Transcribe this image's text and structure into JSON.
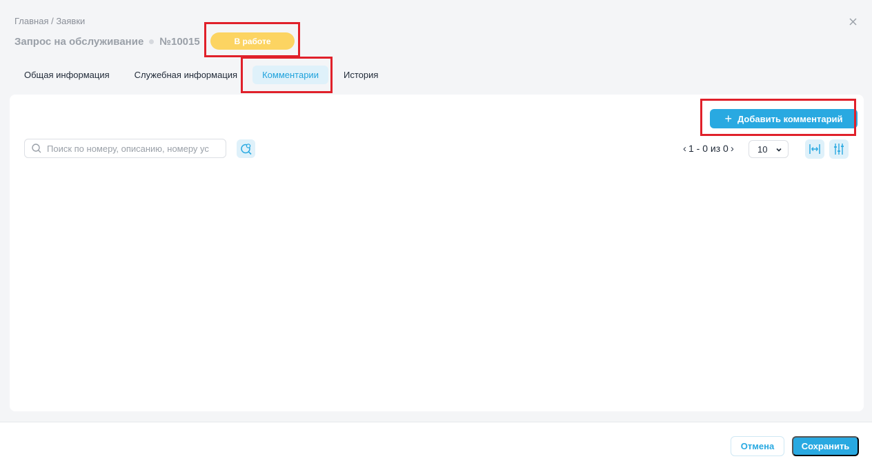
{
  "breadcrumb": "Главная / Заявки",
  "header": {
    "title": "Запрос на обслуживание",
    "number": "№10015",
    "status": "В работе",
    "status_color": "#fcd462"
  },
  "tabs": [
    {
      "label": "Общая информация",
      "active": false
    },
    {
      "label": "Служебная информация",
      "active": false
    },
    {
      "label": "Комментарии",
      "active": true
    },
    {
      "label": "История",
      "active": false
    }
  ],
  "toolbar": {
    "add_comment_label": "Добавить комментарий",
    "search_placeholder": "Поиск по номеру, описанию, номеру ус",
    "pager_text": "1 - 0 из 0",
    "page_size": "10"
  },
  "footer": {
    "cancel_label": "Отмена",
    "save_label": "Сохранить"
  },
  "colors": {
    "accent": "#29a9e1",
    "highlight": "#e0202a"
  },
  "icons": [
    "close-icon",
    "plus-icon",
    "search-icon",
    "advanced-search-icon",
    "chevron-left-icon",
    "chevron-right-icon",
    "chevron-down-icon",
    "column-width-icon",
    "column-settings-icon"
  ]
}
